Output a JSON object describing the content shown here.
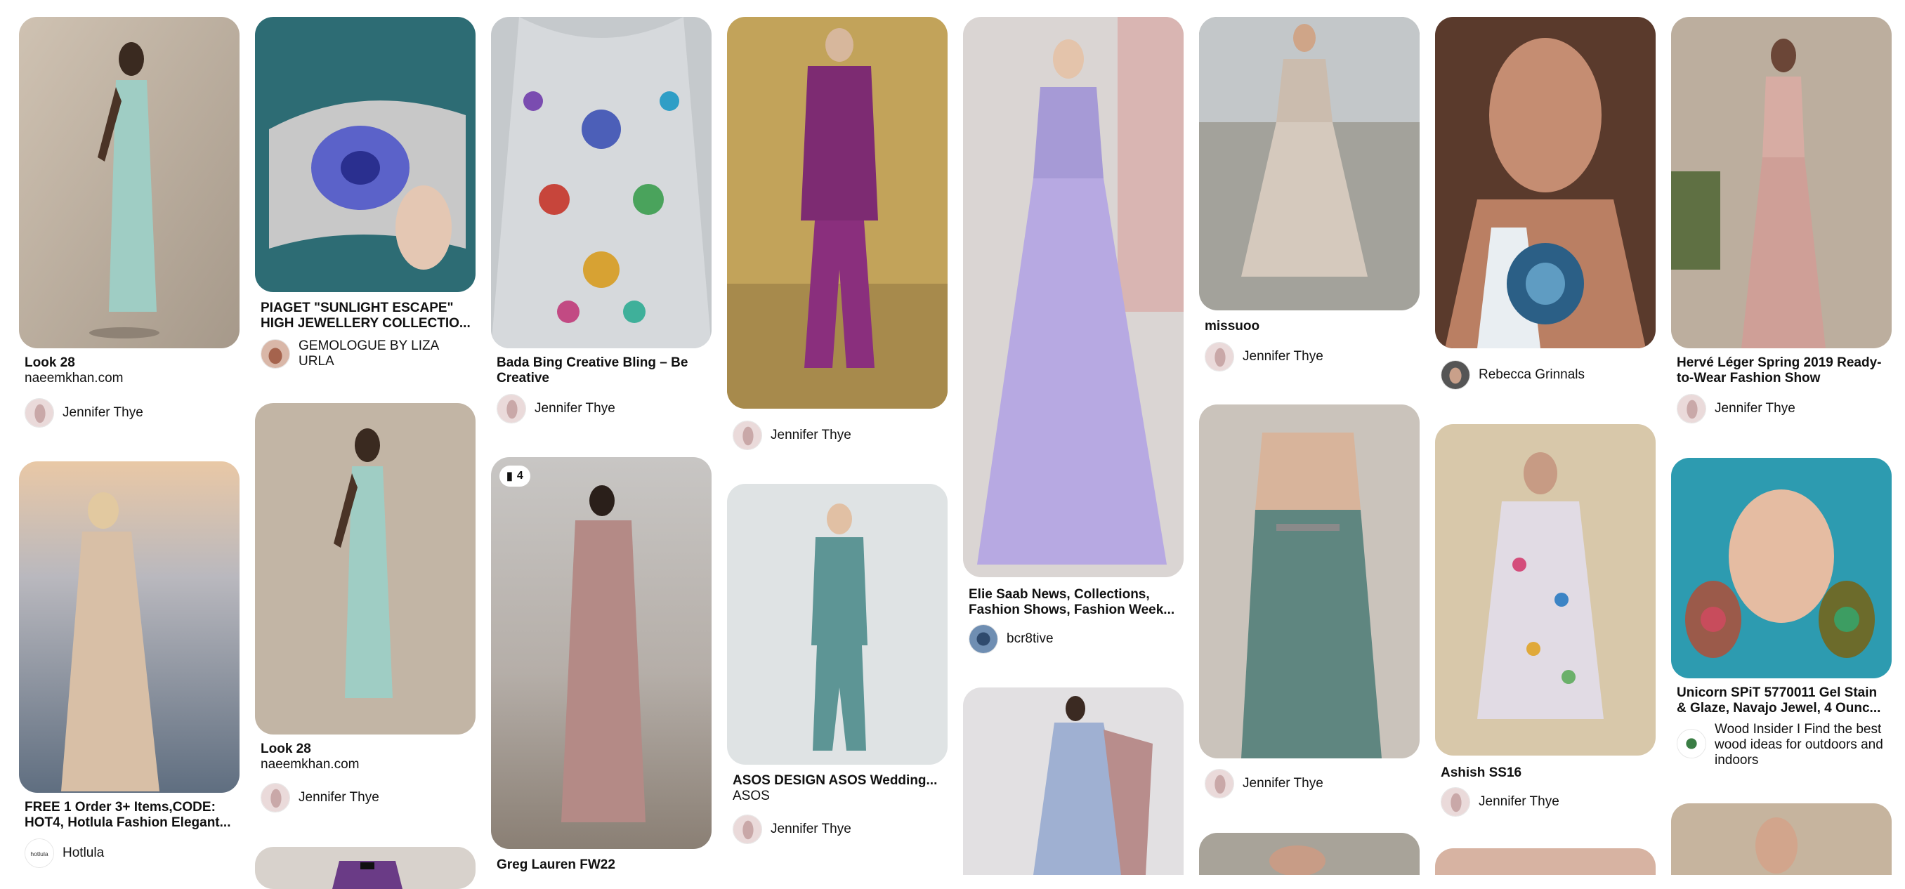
{
  "pins": {
    "look28a": {
      "title": "Look 28",
      "subtitle": "naeemkhan.com",
      "creator": "Jennifer Thye"
    },
    "hotlula": {
      "title": "FREE 1 Order 3+ Items,CODE: HOT4, Hotlula Fashion Elegant...",
      "creator": "Hotlula",
      "avatar_text": "hotlula"
    },
    "piaget": {
      "title": "PIAGET \"SUNLIGHT ESCAPE\" HIGH JEWELLERY COLLECTIO...",
      "creator": "GEMOLOGUE BY LIZA URLA"
    },
    "look28b": {
      "title": "Look 28",
      "subtitle": "naeemkhan.com",
      "creator": "Jennifer Thye"
    },
    "badabing": {
      "title": "Bada Bing Creative Bling – Be Creative",
      "creator": "Jennifer Thye"
    },
    "greglauren": {
      "title": "Greg Lauren FW22",
      "badge_count": "4"
    },
    "purplesuit": {
      "creator": "Jennifer Thye"
    },
    "asos": {
      "title": "ASOS DESIGN ASOS Wedding...",
      "subtitle": "ASOS",
      "creator": "Jennifer Thye"
    },
    "eliesaab": {
      "title": "Elie Saab News, Collections, Fashion Shows, Fashion Week...",
      "creator": "bcr8tive"
    },
    "missuoo": {
      "title": "missuoo",
      "creator": "Jennifer Thye"
    },
    "greendress": {
      "creator": "Jennifer Thye"
    },
    "agate": {
      "creator": "Rebecca Grinnals"
    },
    "ashish": {
      "title": "Ashish SS16",
      "creator": "Jennifer Thye"
    },
    "herve": {
      "title": "Hervé Léger Spring 2019 Ready-to-Wear Fashion Show",
      "creator": "Jennifer Thye"
    },
    "unicorn": {
      "title": "Unicorn SPiT 5770011 Gel Stain & Glaze, Navajo Jewel, 4 Ounc...",
      "creator": "Wood Insider I Find the best wood ideas for outdoors and indoors"
    }
  },
  "colors": {
    "text": "#111111",
    "background": "#ffffff",
    "badge_bg": "#ffffff"
  }
}
